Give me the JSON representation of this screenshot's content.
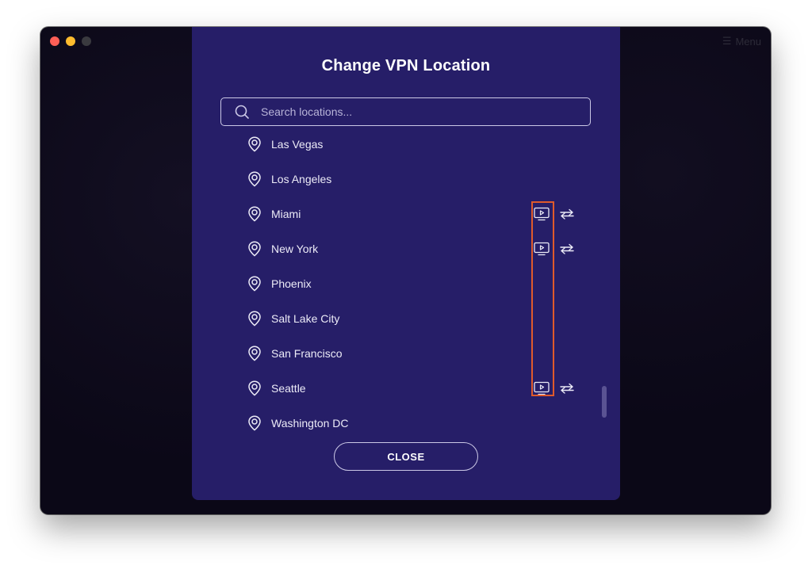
{
  "window": {
    "menu_label": "Menu",
    "traffic_lights": [
      "close",
      "minimize",
      "zoom"
    ]
  },
  "dialog": {
    "title": "Change VPN Location",
    "search": {
      "placeholder": "Search locations...",
      "value": ""
    },
    "locations": [
      {
        "label": "Las Vegas",
        "streaming": false,
        "p2p": false
      },
      {
        "label": "Los Angeles",
        "streaming": false,
        "p2p": false
      },
      {
        "label": "Miami",
        "streaming": true,
        "p2p": true
      },
      {
        "label": "New York",
        "streaming": true,
        "p2p": true
      },
      {
        "label": "Phoenix",
        "streaming": false,
        "p2p": false
      },
      {
        "label": "Salt Lake City",
        "streaming": false,
        "p2p": false
      },
      {
        "label": "San Francisco",
        "streaming": false,
        "p2p": false
      },
      {
        "label": "Seattle",
        "streaming": true,
        "p2p": true
      },
      {
        "label": "Washington DC",
        "streaming": false,
        "p2p": false
      }
    ],
    "close_label": "CLOSE"
  },
  "colors": {
    "dialog_bg": "#261e68",
    "app_bg": "#0b0817",
    "highlight": "#e05a2b",
    "text": "#ecebf7"
  },
  "icons": {
    "search": "search-icon",
    "location": "map-pin-icon",
    "streaming": "tv-play-icon",
    "p2p": "swap-arrows-icon",
    "menu": "hamburger-icon"
  }
}
